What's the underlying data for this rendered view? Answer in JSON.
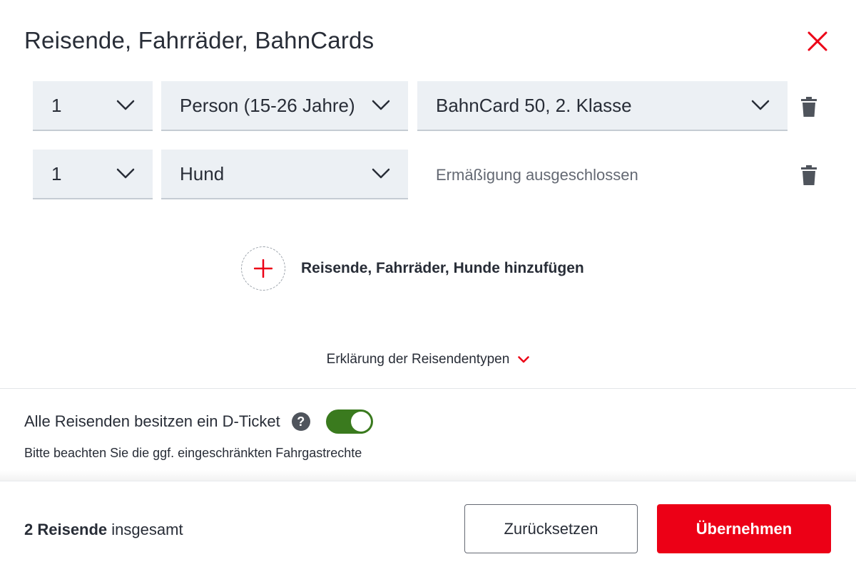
{
  "dialog": {
    "title": "Reisende, Fahrräder, BahnCards",
    "close_icon": "close-icon"
  },
  "rows": [
    {
      "count": "1",
      "type": "Person (15-26 Jahre)",
      "discount": "BahnCard 50, 2. Klasse",
      "delete_icon": "trash-icon"
    },
    {
      "count": "1",
      "type": "Hund",
      "discount_note": "Ermäßigung ausgeschlossen",
      "delete_icon": "trash-icon"
    }
  ],
  "add": {
    "label": "Reisende, Fahrräder, Hunde hinzufügen",
    "icon": "plus-icon"
  },
  "explanation": {
    "label": "Erklärung der Reisendentypen",
    "icon": "chevron-down-icon"
  },
  "dticket": {
    "label": "Alle Reisenden besitzen ein D-Ticket",
    "help_symbol": "?",
    "toggle_on": true,
    "note": "Bitte beachten Sie die ggf. eingeschränkten Fahrgastrechte"
  },
  "footer": {
    "total_bold": "2 Reisende",
    "total_rest": " insgesamt",
    "reset_label": "Zurücksetzen",
    "apply_label": "Übernehmen"
  },
  "colors": {
    "accent_red": "#ec0016",
    "toggle_green": "#3a7a1e",
    "select_bg": "#ecf0f4"
  }
}
